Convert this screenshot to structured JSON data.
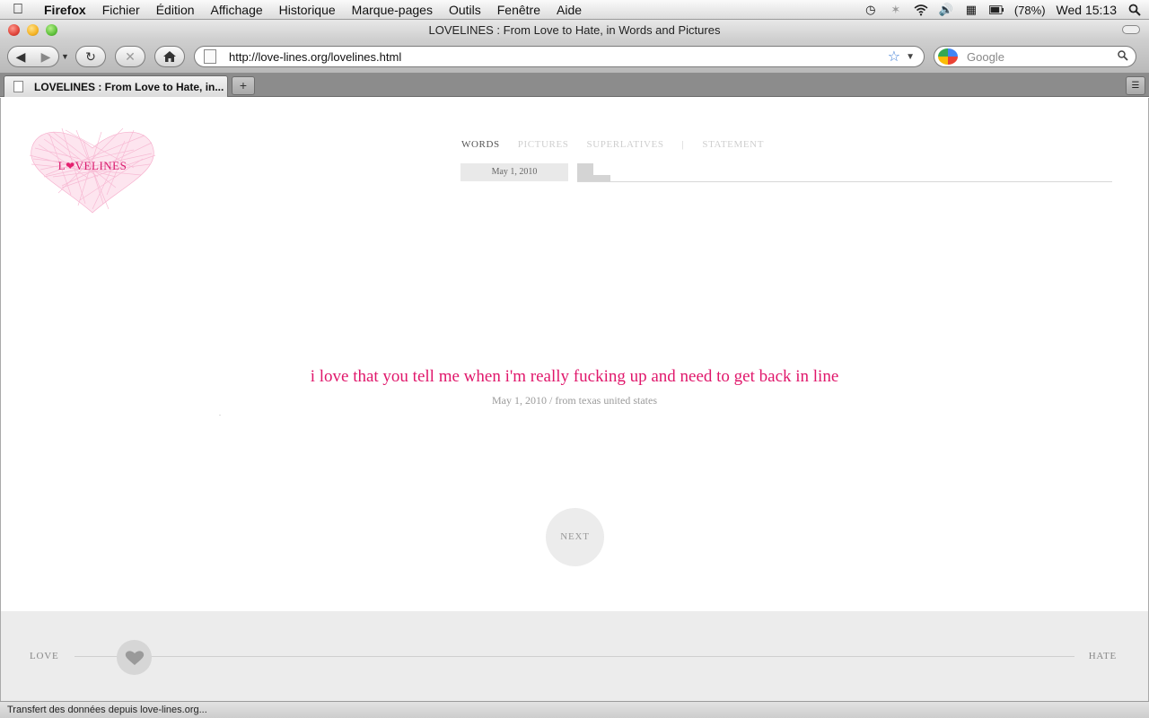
{
  "menubar": {
    "app_name": "Firefox",
    "items": [
      "Fichier",
      "Édition",
      "Affichage",
      "Historique",
      "Marque-pages",
      "Outils",
      "Fenêtre",
      "Aide"
    ],
    "battery": "(78%)",
    "clock": "Wed 15:13"
  },
  "window": {
    "title": "LOVELINES : From Love to Hate, in Words and Pictures"
  },
  "toolbar": {
    "url": "http://love-lines.org/lovelines.html",
    "search_placeholder": "Google"
  },
  "tabs": {
    "active_label": "LOVELINES : From Love to Hate, in...",
    "new_tab_label": "+"
  },
  "site": {
    "logo_prefix": "L",
    "logo_suffix": "VELINES",
    "nav": {
      "words": "WORDS",
      "pictures": "PICTURES",
      "superlatives": "SUPERLATIVES",
      "separator": "|",
      "statement": "STATEMENT"
    },
    "date_box": "May 1, 2010",
    "quote": "i love that you tell me when i'm really fucking up and need to get back in line",
    "quote_meta": "May 1, 2010 / from texas united states",
    "next_label": "NEXT",
    "slider": {
      "left_label": "LOVE",
      "right_label": "HATE",
      "position_fraction": 0.06
    }
  },
  "status": {
    "text": "Transfert des données depuis love-lines.org..."
  },
  "colors": {
    "accent_pink": "#e0176b",
    "logo_pink": "#f7b4d0"
  }
}
